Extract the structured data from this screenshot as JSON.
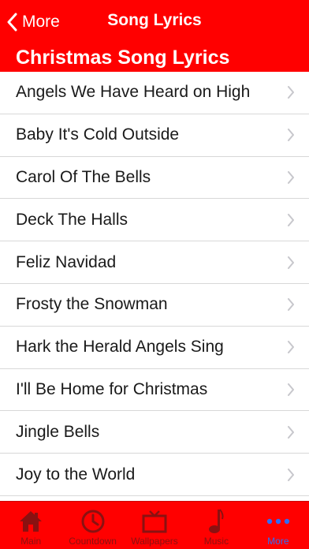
{
  "nav": {
    "back_label": "More",
    "title": "Song Lyrics"
  },
  "section": {
    "title": "Christmas Song Lyrics"
  },
  "songs": [
    "Angels We Have Heard on High",
    "Baby It's Cold Outside",
    "Carol Of The Bells",
    "Deck The Halls",
    "Feliz Navidad",
    "Frosty the Snowman",
    "Hark the Herald Angels Sing",
    "I'll Be Home for Christmas",
    "Jingle Bells",
    "Joy to the World"
  ],
  "tabs": [
    {
      "label": "Main",
      "icon": "house-icon",
      "active": false
    },
    {
      "label": "Countdown",
      "icon": "clock-icon",
      "active": false
    },
    {
      "label": "Wallpapers",
      "icon": "tv-icon",
      "active": false
    },
    {
      "label": "Music",
      "icon": "music-note-icon",
      "active": false
    },
    {
      "label": "More",
      "icon": "more-dots-icon",
      "active": true
    }
  ],
  "colors": {
    "brand_red": "#ff0000",
    "inactive_tab": "#8a1111",
    "active_tab": "#2f6df7",
    "chevron": "#c7c7cc"
  }
}
